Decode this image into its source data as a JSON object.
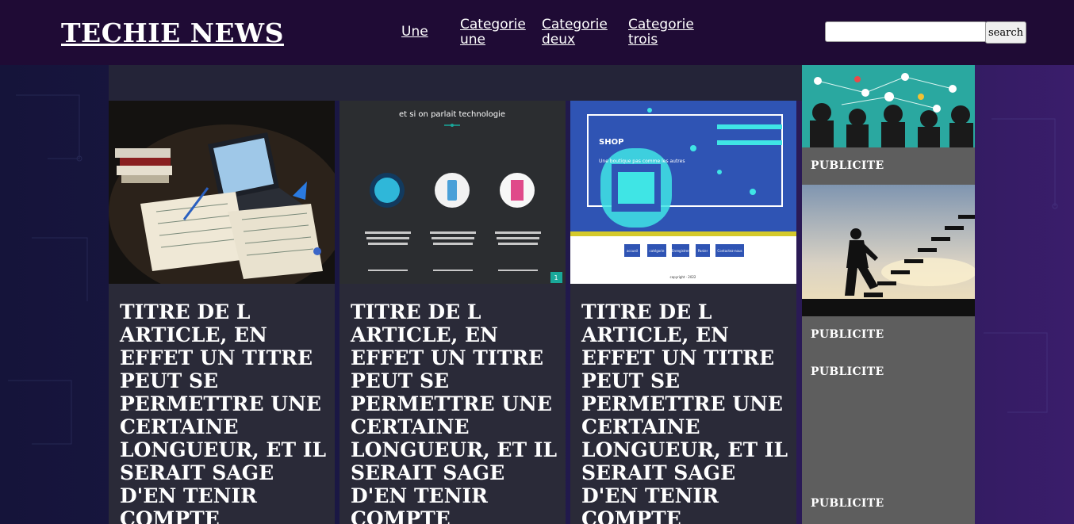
{
  "site": {
    "logo": "TECHIE NEWS"
  },
  "nav": {
    "items": [
      {
        "line1": "Une",
        "line2": ""
      },
      {
        "line1": "Categorie",
        "line2": "une"
      },
      {
        "line1": "Categorie",
        "line2": "deux"
      },
      {
        "line1": "Categorie",
        "line2": "trois"
      }
    ]
  },
  "search": {
    "button_label": "search",
    "value": ""
  },
  "articles": [
    {
      "title": "TITRE DE L ARTICLE, EN EFFET UN TITRE PEUT SE PERMETTRE UNE CERTAINE LONGUEUR, ET IL SERAIT SAGE D'EN TENIR COMPTE",
      "image": "notebook-laptop-photo"
    },
    {
      "title": "TITRE DE L ARTICLE, EN EFFET UN TITRE PEUT SE PERMETTRE UNE CERTAINE LONGUEUR, ET IL SERAIT SAGE D'EN TENIR COMPTE",
      "image": "website-screenshot",
      "image_text": {
        "heading": "et si on parlait technologie",
        "col1": "Vous avez pour publier quelques idées",
        "col2": "Web mobile, ou ouvrage quiphone",
        "col3": "Un système ouvert dans le monde",
        "badge": "1"
      }
    },
    {
      "title": "TITRE DE L ARTICLE, EN EFFET UN TITRE PEUT SE PERMETTRE UNE CERTAINE LONGUEUR, ET IL SERAIT SAGE D'EN TENIR COMPTE",
      "image": "shop-website-screenshot",
      "image_text": {
        "shop": "SHOP",
        "tagline": "Une boutique pas comme les autres",
        "buttons": [
          "accueil",
          "catégorie",
          "Enregistrer",
          "Panier",
          "Contactez-nous"
        ],
        "footer": "copyright · 2022"
      }
    }
  ],
  "sidebar": {
    "ads": [
      "PUBLICITE",
      "PUBLICITE",
      "PUBLICITE",
      "PUBLICITE"
    ],
    "image1": "network-people-illustration",
    "image2": "man-climbing-stairs-photo"
  },
  "colors": {
    "header_bg": "#1f0b35",
    "sidebar_bg": "#5e5e5e",
    "card_bg": "#2a2a38",
    "accent_teal": "#19a89a",
    "shop_blue": "#2f54b4",
    "shop_cyan": "#3fe5e5"
  }
}
